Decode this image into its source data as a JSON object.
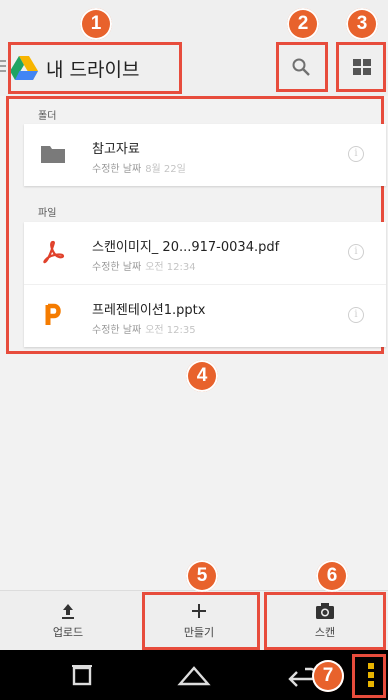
{
  "header": {
    "title": "내 드라이브",
    "icons": [
      "menu-icon",
      "google-drive-logo",
      "search-icon",
      "grid-view-icon"
    ]
  },
  "callouts": [
    "1",
    "2",
    "3",
    "4",
    "5",
    "6",
    "7"
  ],
  "sections": {
    "folders_label": "폴더",
    "files_label": "파일"
  },
  "folders": [
    {
      "name": "참고자료",
      "meta_label": "수정한 날짜",
      "meta_time": "8월 22일",
      "icon": "folder-icon"
    }
  ],
  "files": [
    {
      "name": "스캔이미지_ 20...917-0034.pdf",
      "meta_label": "수정한 날짜",
      "meta_time": "오전 12:34",
      "icon": "pdf-icon"
    },
    {
      "name": "프레젠테이션1.pptx",
      "meta_label": "수정한 날짜",
      "meta_time": "오전 12:35",
      "icon": "slides-icon"
    }
  ],
  "bottom_bar": {
    "upload_label": "업로드",
    "create_label": "만들기",
    "scan_label": "스캔"
  },
  "colors": {
    "callout": "#e8622c",
    "highlight": "#e74c3c",
    "pdf": "#e0412b",
    "slides": "#f57c00"
  }
}
